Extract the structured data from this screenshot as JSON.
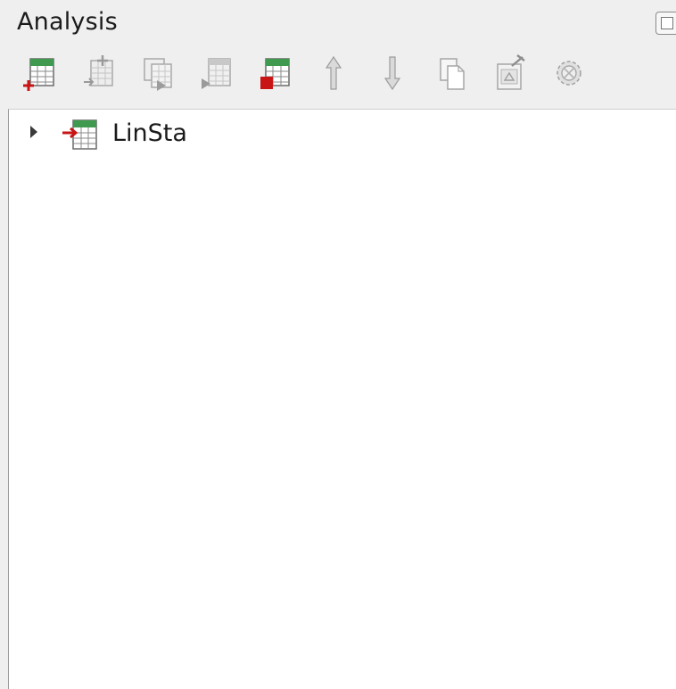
{
  "panel": {
    "title": "Analysis"
  },
  "toolbar": {
    "buttons": [
      {
        "name": "add-analysis-icon",
        "enabled": true
      },
      {
        "name": "import-analysis-icon",
        "enabled": false
      },
      {
        "name": "duplicate-analysis-icon",
        "enabled": false
      },
      {
        "name": "run-analysis-icon",
        "enabled": false
      },
      {
        "name": "remove-analysis-icon",
        "enabled": true
      },
      {
        "name": "move-up-icon",
        "enabled": false
      },
      {
        "name": "move-down-icon",
        "enabled": false
      },
      {
        "name": "copy-icon",
        "enabled": false
      },
      {
        "name": "properties-icon",
        "enabled": false
      },
      {
        "name": "settings-icon",
        "enabled": false
      }
    ]
  },
  "tree": {
    "items": [
      {
        "label": "LinSta",
        "expanded": false
      }
    ]
  },
  "colors": {
    "panel_bg": "#efefef",
    "tree_bg": "#ffffff",
    "icon_green": "#3f9a4f",
    "icon_red": "#c81414",
    "icon_disabled": "#b4b4b4"
  }
}
